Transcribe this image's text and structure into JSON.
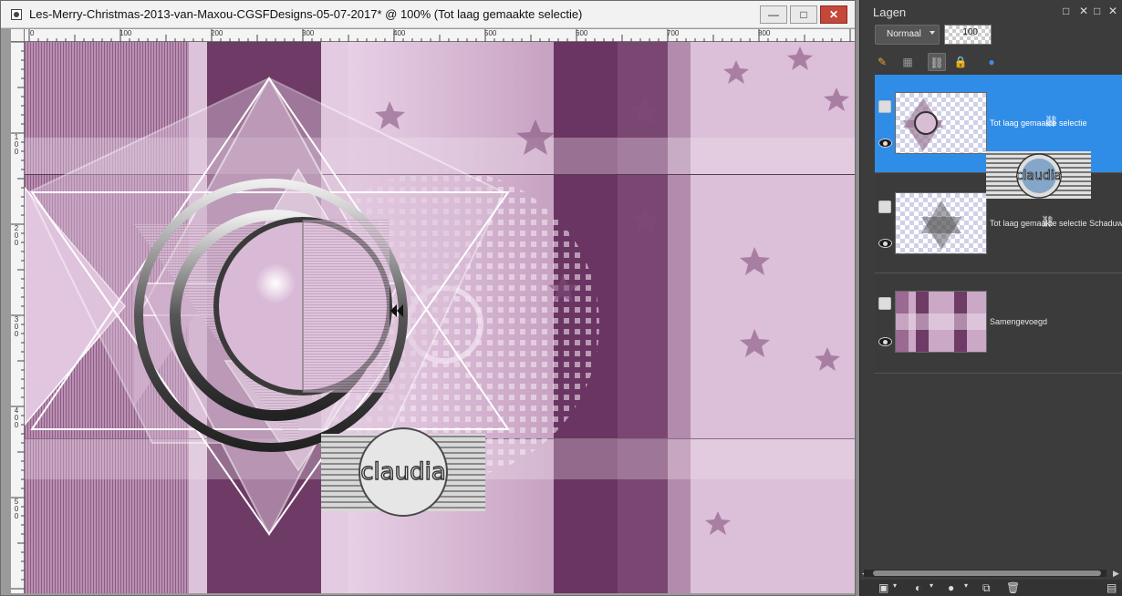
{
  "document": {
    "title": "Les-Merry-Christmas-2013-van-Maxou-CGSFDesigns-05-07-2017* @ 100% (Tot laag gemaakte selectie)",
    "controls": {
      "minimize": "—",
      "maximize": "□",
      "close": "✕"
    },
    "ruler_top_labels": [
      "0",
      "100",
      "200",
      "300",
      "400",
      "500",
      "600",
      "700",
      "800"
    ],
    "ruler_left_labels": [
      "100",
      "200",
      "300",
      "400",
      "500"
    ],
    "watermark": "claudia"
  },
  "layers_panel": {
    "title": "Lagen",
    "header_controls": [
      "□",
      "✕",
      "□",
      "✕"
    ],
    "blend_mode": "Normaal",
    "opacity": "100",
    "layers": [
      {
        "name": "Tot laag gemaakte selectie",
        "selected": true,
        "icon": "raster-layer-icon"
      },
      {
        "name": "Tot laag gemaakte selectie Schaduw",
        "selected": false,
        "icon": "raster-layer-icon"
      },
      {
        "name": "Samengevoegd",
        "selected": false,
        "icon": "raster-layer-icon"
      }
    ]
  },
  "colors": {
    "selection": "#2f8de8",
    "panel_bg": "#3c3c3c",
    "canvas_mauve": "#c9a9c5",
    "canvas_plum": "#6f3a66"
  }
}
